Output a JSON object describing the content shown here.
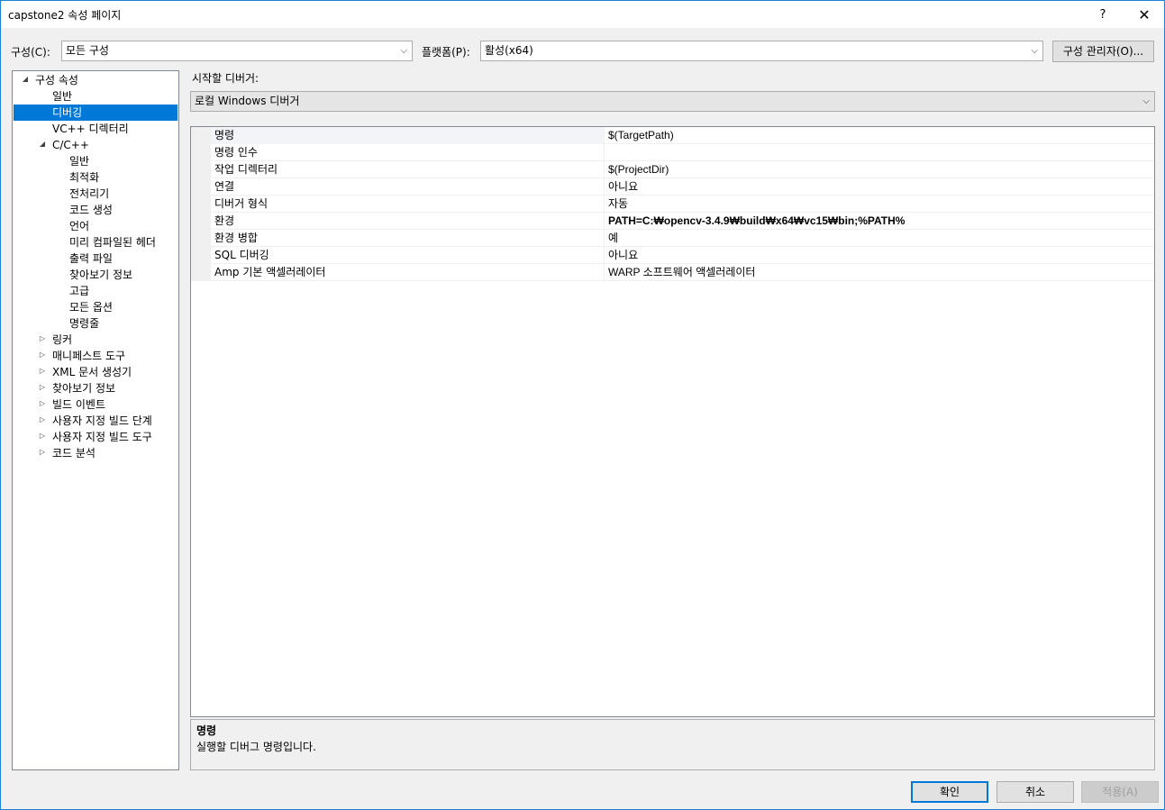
{
  "window": {
    "title": "capstone2 속성 페이지",
    "help": "?",
    "close": "✕"
  },
  "config": {
    "label": "구성(C):",
    "value": "모든 구성"
  },
  "platform": {
    "label": "플랫폼(P):",
    "value": "활성(x64)"
  },
  "config_manager": "구성 관리자(O)...",
  "tree": [
    {
      "label": "구성 속성",
      "level": 0,
      "expander": "◢"
    },
    {
      "label": "일반",
      "level": 1,
      "expander": ""
    },
    {
      "label": "디버깅",
      "level": 1,
      "expander": "",
      "selected": true
    },
    {
      "label": "VC++ 디렉터리",
      "level": 1,
      "expander": ""
    },
    {
      "label": "C/C++",
      "level": 1,
      "expander": "◢"
    },
    {
      "label": "일반",
      "level": 2,
      "expander": ""
    },
    {
      "label": "최적화",
      "level": 2,
      "expander": ""
    },
    {
      "label": "전처리기",
      "level": 2,
      "expander": ""
    },
    {
      "label": "코드 생성",
      "level": 2,
      "expander": ""
    },
    {
      "label": "언어",
      "level": 2,
      "expander": ""
    },
    {
      "label": "미리 컴파일된 헤더",
      "level": 2,
      "expander": ""
    },
    {
      "label": "출력 파일",
      "level": 2,
      "expander": ""
    },
    {
      "label": "찾아보기 정보",
      "level": 2,
      "expander": ""
    },
    {
      "label": "고급",
      "level": 2,
      "expander": ""
    },
    {
      "label": "모든 옵션",
      "level": 2,
      "expander": ""
    },
    {
      "label": "명령줄",
      "level": 2,
      "expander": ""
    },
    {
      "label": "링커",
      "level": 1,
      "expander": "▷"
    },
    {
      "label": "매니페스트 도구",
      "level": 1,
      "expander": "▷"
    },
    {
      "label": "XML 문서 생성기",
      "level": 1,
      "expander": "▷"
    },
    {
      "label": "찾아보기 정보",
      "level": 1,
      "expander": "▷"
    },
    {
      "label": "빌드 이벤트",
      "level": 1,
      "expander": "▷"
    },
    {
      "label": "사용자 지정 빌드 단계",
      "level": 1,
      "expander": "▷"
    },
    {
      "label": "사용자 지정 빌드 도구",
      "level": 1,
      "expander": "▷"
    },
    {
      "label": "코드 분석",
      "level": 1,
      "expander": "▷"
    }
  ],
  "debugger_label": "시작할 디버거:",
  "debugger_value": "로컬 Windows 디버거",
  "properties": [
    {
      "name": "명령",
      "value": "$(TargetPath)",
      "bold": false
    },
    {
      "name": "명령 인수",
      "value": "",
      "bold": false
    },
    {
      "name": "작업 디렉터리",
      "value": "$(ProjectDir)",
      "bold": false
    },
    {
      "name": "연결",
      "value": "아니요",
      "bold": false
    },
    {
      "name": "디버거 형식",
      "value": "자동",
      "bold": false
    },
    {
      "name": "환경",
      "value": "PATH=C:₩opencv-3.4.9₩build₩x64₩vc15₩bin;%PATH%",
      "bold": true
    },
    {
      "name": "환경 병합",
      "value": "예",
      "bold": false
    },
    {
      "name": "SQL 디버깅",
      "value": "아니요",
      "bold": false
    },
    {
      "name": "Amp 기본 액셀러레이터",
      "value": "WARP 소프트웨어 액셀러레이터",
      "bold": false
    }
  ],
  "description": {
    "title": "명령",
    "text": "실행할 디버그 명령입니다."
  },
  "buttons": {
    "ok": "확인",
    "cancel": "취소",
    "apply": "적용(A)"
  }
}
